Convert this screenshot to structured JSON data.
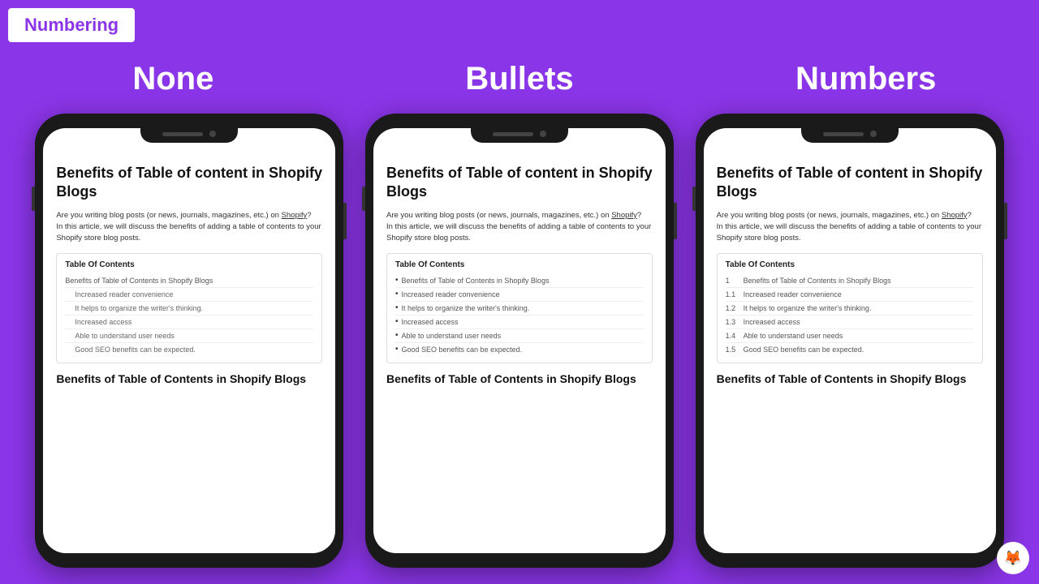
{
  "header": {
    "label": "Numbering"
  },
  "columns": [
    {
      "title": "None"
    },
    {
      "title": "Bullets"
    },
    {
      "title": "Numbers"
    }
  ],
  "blog": {
    "title": "Benefits of Table of content in Shopify Blogs",
    "body_line1": "Are you writing blog posts (or news, journals, magazines, etc.) on ",
    "shopify_link": "Shopify",
    "body_line1_end": "?",
    "body_line2": "In this article, we will discuss the benefits of adding a table of contents to your Shopify store blog posts.",
    "toc_title": "Table Of Contents",
    "toc_items": [
      {
        "label": "Benefits of Table of Contents in Shopify Blogs",
        "level": 1
      },
      {
        "label": "Increased reader convenience",
        "level": 2
      },
      {
        "label": "It helps to organize the writer's thinking.",
        "level": 2
      },
      {
        "label": "Increased access",
        "level": 2
      },
      {
        "label": "Able to understand user needs",
        "level": 2
      },
      {
        "label": "Good SEO benefits can be expected.",
        "level": 2
      }
    ],
    "footer_heading": "Benefits of Table of Contents in Shopify Blogs"
  }
}
